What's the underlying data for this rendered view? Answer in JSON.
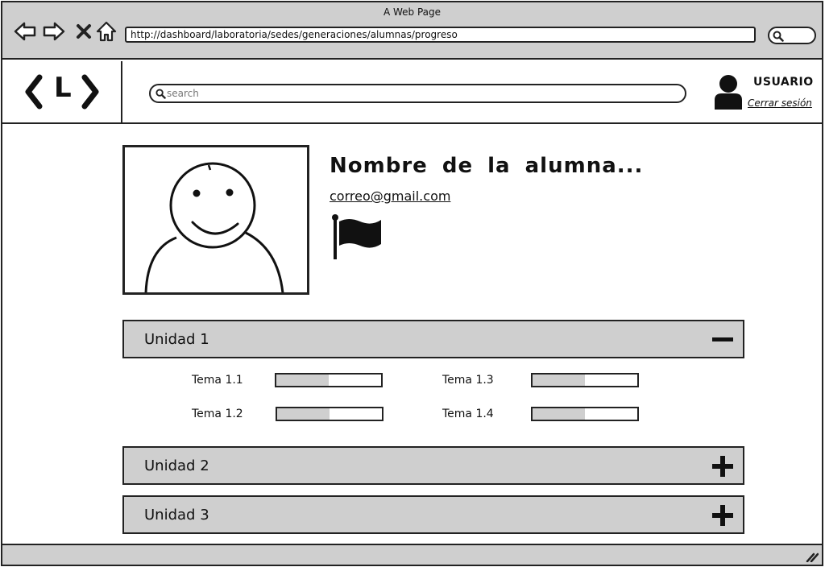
{
  "window": {
    "title": "A Web Page"
  },
  "browser": {
    "url": "http://dashboard/laboratoria/sedes/generaciones/alumnas/progreso",
    "nav": {
      "back_icon": "arrow-left-icon",
      "forward_icon": "arrow-right-icon",
      "stop_icon": "close-icon",
      "home_icon": "home-icon"
    }
  },
  "header": {
    "logo_text": "L",
    "search": {
      "placeholder": "search",
      "value": ""
    },
    "user": {
      "name": "USUARIO",
      "logout_label": "Cerrar sesión"
    }
  },
  "student": {
    "name": "Nombre de la alumna...",
    "email": "correo@gmail.com",
    "flag_icon": "flag-icon"
  },
  "units": [
    {
      "label": "Unidad 1",
      "state": "expanded",
      "toggle_icon": "minus-icon",
      "topics": [
        {
          "label": "Tema 1.1",
          "progress": 0.5
        },
        {
          "label": "Tema 1.2",
          "progress": 0.5
        },
        {
          "label": "Tema 1.3",
          "progress": 0.5
        },
        {
          "label": "Tema 1.4",
          "progress": 0.5
        }
      ]
    },
    {
      "label": "Unidad 2",
      "state": "collapsed",
      "toggle_icon": "plus-icon"
    },
    {
      "label": "Unidad 3",
      "state": "collapsed",
      "toggle_icon": "plus-icon"
    }
  ],
  "colors": {
    "panel": "#cfcfcf",
    "stroke": "#222222",
    "background": "#ffffff"
  }
}
